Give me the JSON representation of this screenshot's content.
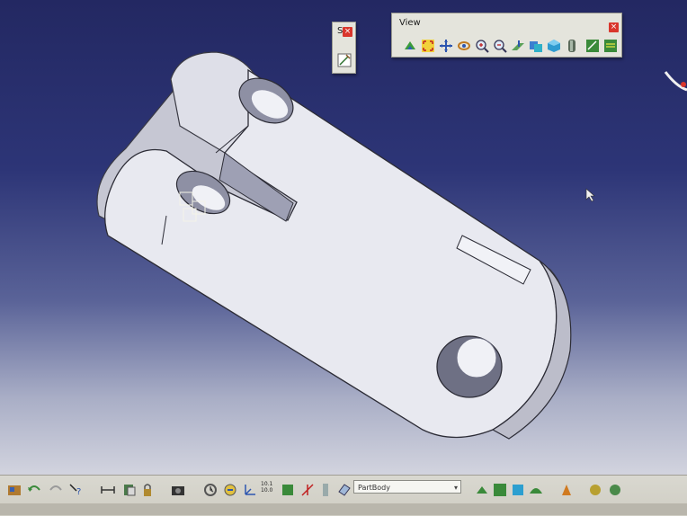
{
  "view_toolbar": {
    "title": "View",
    "close": "×",
    "icons": [
      "fly-mode-icon",
      "fit-all-icon",
      "pan-icon",
      "rotate-icon",
      "zoom-in-icon",
      "zoom-out-icon",
      "normal-view-icon",
      "multi-view-icon",
      "iso-view-icon",
      "shading-icon",
      "hide-show-icon",
      "swap-space-icon"
    ]
  },
  "mini_panel": {
    "title": "S",
    "close": "×"
  },
  "bottom_toolbar": {
    "select_value": "PartBody",
    "select_arrow": "▾",
    "measure_label_top": "10.1",
    "measure_label_bottom": "10.0"
  },
  "colors": {
    "background_top": "#232862",
    "background_bottom": "#d8d9e2",
    "part_face": "#e6e7ee",
    "part_side": "#c9cad6",
    "accent_red": "#d9362c"
  }
}
